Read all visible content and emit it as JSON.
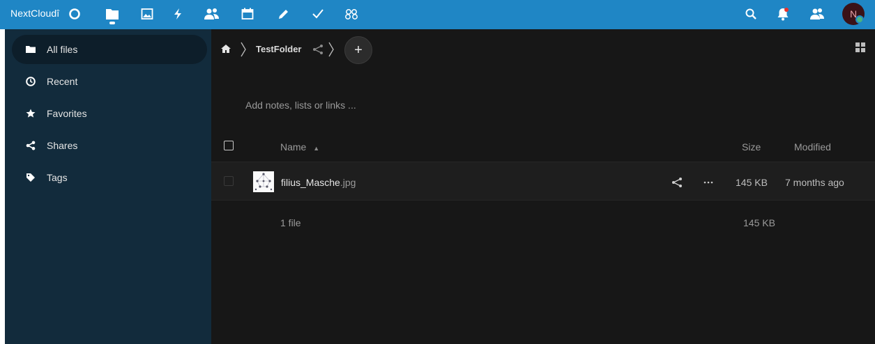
{
  "header": {
    "brand": "NextCloudî",
    "apps": [
      {
        "icon": "dashboard-icon",
        "label": "Dashboard"
      },
      {
        "icon": "files-icon",
        "label": "Files"
      },
      {
        "icon": "photos-icon",
        "label": "Photos"
      },
      {
        "icon": "activity-icon",
        "label": "Activity"
      },
      {
        "icon": "contacts-icon",
        "label": "Contacts"
      },
      {
        "icon": "calendar-icon",
        "label": "Calendar"
      },
      {
        "icon": "notes-icon",
        "label": "Notes"
      },
      {
        "icon": "tasks-icon",
        "label": "Tasks"
      },
      {
        "icon": "circles-icon",
        "label": "Circles"
      }
    ],
    "avatar_initial": "N",
    "accent": "#1f86c5"
  },
  "sidebar": {
    "items": [
      {
        "label": "All files",
        "icon": "folder-icon",
        "active": true
      },
      {
        "label": "Recent",
        "icon": "clock-icon"
      },
      {
        "label": "Favorites",
        "icon": "star-icon"
      },
      {
        "label": "Shares",
        "icon": "share-icon"
      },
      {
        "label": "Tags",
        "icon": "tag-icon"
      }
    ]
  },
  "breadcrumb": {
    "folder": "TestFolder",
    "add_label": "+"
  },
  "notes_placeholder": "Add notes, lists or links ...",
  "table": {
    "columns": {
      "name": "Name",
      "size": "Size",
      "modified": "Modified"
    },
    "rows": [
      {
        "name": "filius_Masche",
        "ext": ".jpg",
        "size": "145 KB",
        "modified": "7 months ago"
      }
    ],
    "summary": {
      "count": "1 file",
      "size": "145 KB"
    }
  }
}
